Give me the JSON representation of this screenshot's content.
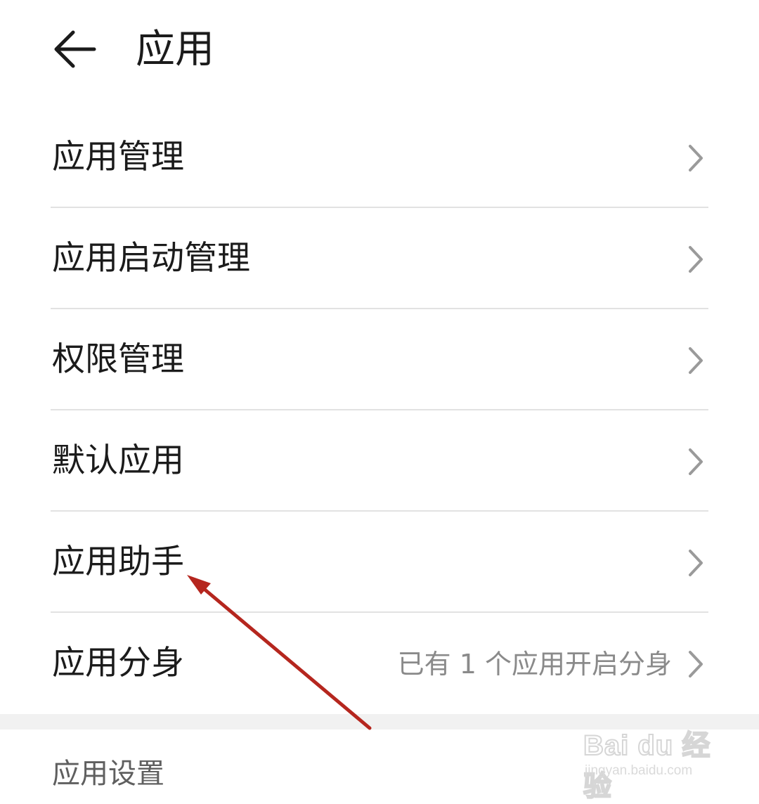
{
  "header": {
    "title": "应用",
    "back_icon": "arrow-left-icon"
  },
  "menu": {
    "items": [
      {
        "label": "应用管理",
        "value": ""
      },
      {
        "label": "应用启动管理",
        "value": ""
      },
      {
        "label": "权限管理",
        "value": ""
      },
      {
        "label": "默认应用",
        "value": ""
      },
      {
        "label": "应用助手",
        "value": ""
      },
      {
        "label": "应用分身",
        "value": "已有 1 个应用开启分身"
      }
    ],
    "chevron_icon": "chevron-right-icon"
  },
  "section": {
    "header": "应用设置"
  },
  "annotation": {
    "arrow_color": "#b5261e",
    "points_to": "应用助手"
  },
  "watermark": {
    "logo": "Bai du 经验",
    "url": "jingyan.baidu.com"
  },
  "colors": {
    "background": "#ffffff",
    "text_primary": "#1b1b1b",
    "text_secondary": "#8a8a8a",
    "divider": "#e2e2e2",
    "section_gap": "#f1f1f1"
  }
}
